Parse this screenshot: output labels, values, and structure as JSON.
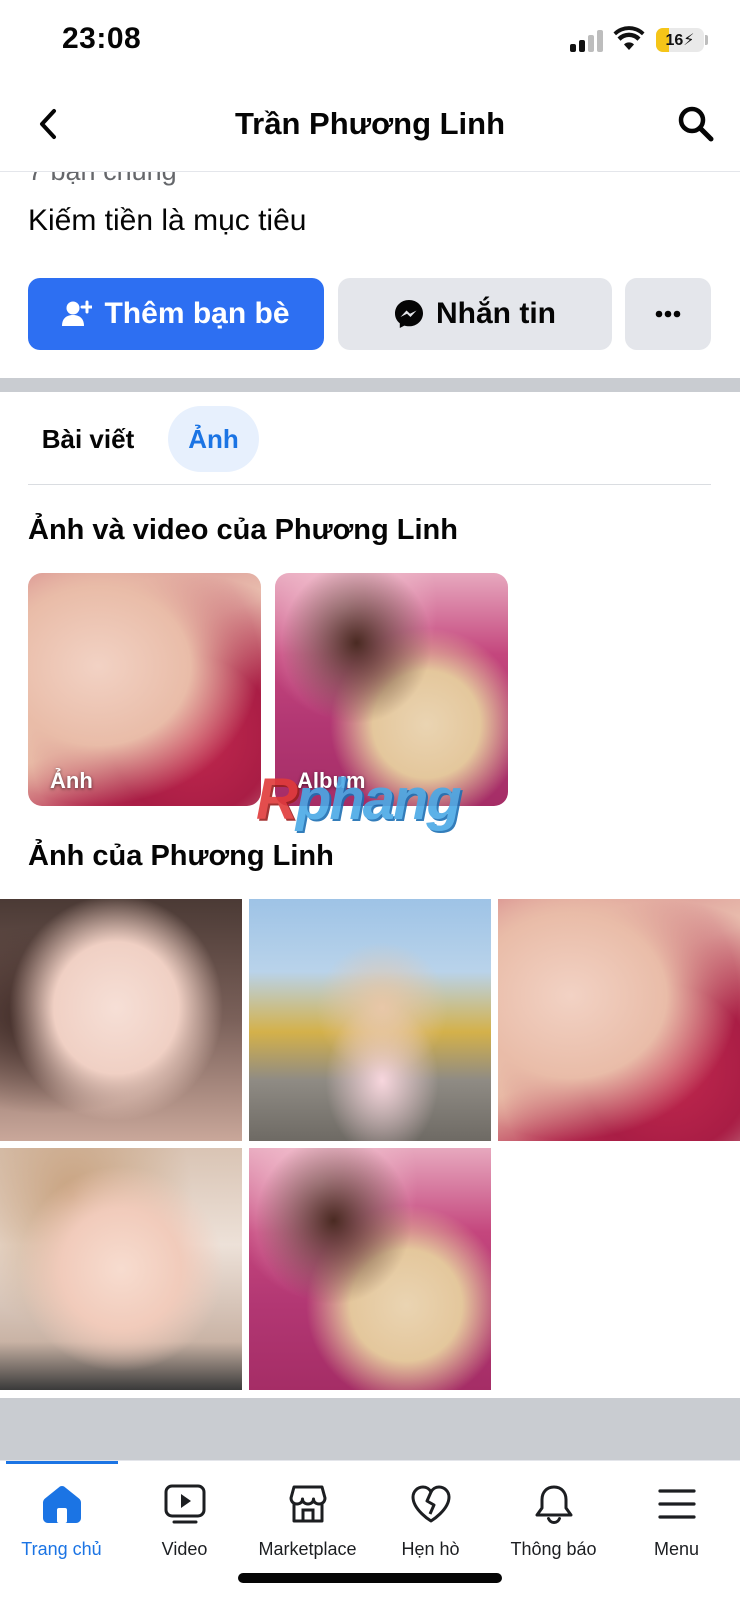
{
  "status_bar": {
    "time": "23:08",
    "battery": "16"
  },
  "header": {
    "title": "Trần Phương Linh"
  },
  "profile": {
    "mutual_friends": "7 bạn chung",
    "bio": "Kiếm tiền là mục tiêu",
    "add_friend_label": "Thêm bạn bè",
    "message_label": "Nhắn tin"
  },
  "tabs": [
    {
      "label": "Bài viết",
      "active": false
    },
    {
      "label": "Ảnh",
      "active": true
    }
  ],
  "sections": {
    "albums_title": "Ảnh và video của Phương Linh",
    "albums": [
      {
        "caption": "Ảnh"
      },
      {
        "caption": "Album"
      }
    ],
    "photos_title": "Ảnh của Phương Linh"
  },
  "watermark": {
    "first": "R",
    "rest": "phang"
  },
  "bottom_nav": [
    {
      "label": "Trang chủ",
      "icon": "home-icon",
      "active": true
    },
    {
      "label": "Video",
      "icon": "video-icon",
      "active": false
    },
    {
      "label": "Marketplace",
      "icon": "marketplace-icon",
      "active": false
    },
    {
      "label": "Hẹn hò",
      "icon": "dating-icon",
      "active": false
    },
    {
      "label": "Thông báo",
      "icon": "bell-icon",
      "active": false
    },
    {
      "label": "Menu",
      "icon": "menu-icon",
      "active": false
    }
  ],
  "colors": {
    "accent": "#1b74e4",
    "button_primary": "#2d6ff2",
    "secondary_button": "#e4e6eb"
  }
}
